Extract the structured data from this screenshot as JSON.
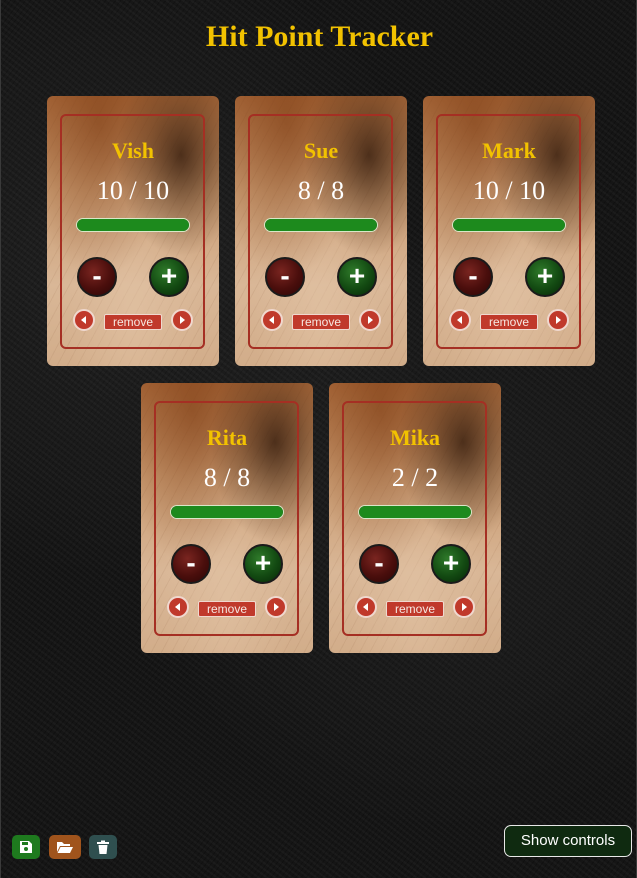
{
  "title": "Hit Point Tracker",
  "players": [
    {
      "name": "Vish",
      "hp_text": "10 / 10",
      "hp_fraction": 1.0
    },
    {
      "name": "Sue",
      "hp_text": "8 / 8",
      "hp_fraction": 1.0
    },
    {
      "name": "Mark",
      "hp_text": "10 / 10",
      "hp_fraction": 1.0
    },
    {
      "name": "Rita",
      "hp_text": "8 / 8",
      "hp_fraction": 1.0
    },
    {
      "name": "Mika",
      "hp_text": "2 / 2",
      "hp_fraction": 1.0
    }
  ],
  "controls": {
    "minus_label": "-",
    "plus_label": "+",
    "remove_label": "remove",
    "move_left_icon": "chevron-left-icon",
    "move_right_icon": "chevron-right-icon"
  },
  "toolbar": {
    "save_icon": "save-icon",
    "open_icon": "folder-open-icon",
    "delete_icon": "trash-icon",
    "save_color": "#1e7a1e",
    "open_color": "#a0541c",
    "delete_color": "#2f4f4f"
  },
  "show_controls_label": "Show controls",
  "colors": {
    "title": "#f2c200",
    "name": "#f2c200",
    "hp_bar": "#1d8a1d",
    "card_border": "#a52f23",
    "action_red": "#c0392b"
  }
}
